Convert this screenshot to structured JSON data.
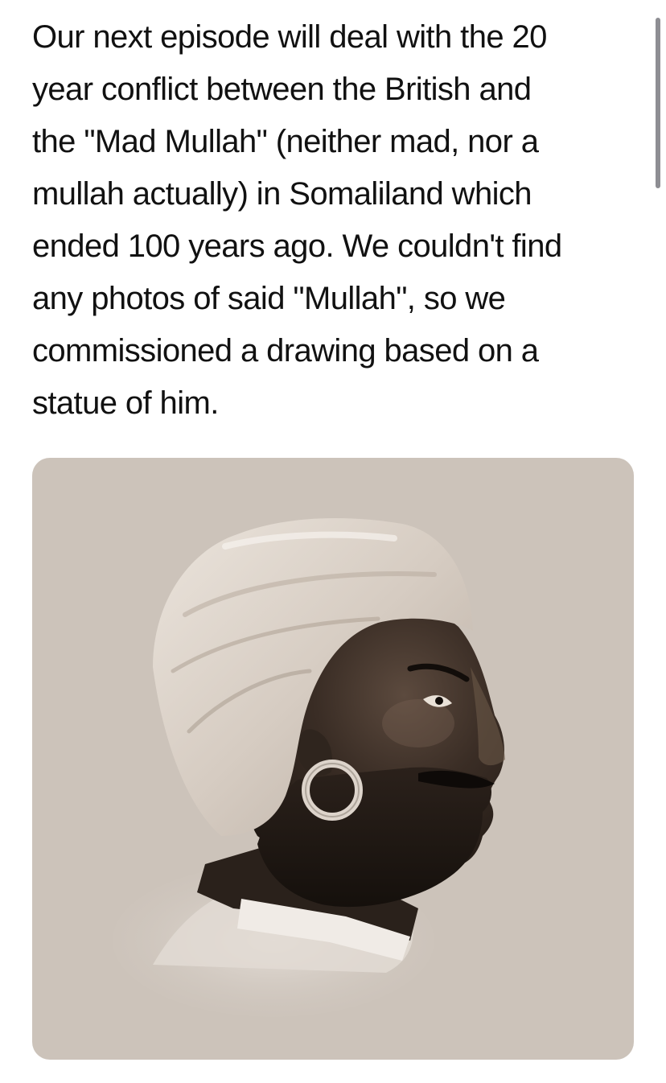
{
  "post": {
    "text": "Our next episode will deal with the 20\nyear conflict between the British and\nthe \"Mad Mullah\" (neither mad, nor a\nmullah actually) in Somaliland which\nended 100 years ago. We couldn't find\nany photos of said \"Mullah\", so we\ncommissioned a drawing based on a\nstatue of him."
  },
  "image": {
    "subject": "portrait-drawing-of-turbaned-bearded-man-in-profile",
    "background_color": "#ccc3ba"
  },
  "colors": {
    "text": "#111111",
    "page_background": "#ffffff",
    "scrollbar": "#8e8e93"
  }
}
